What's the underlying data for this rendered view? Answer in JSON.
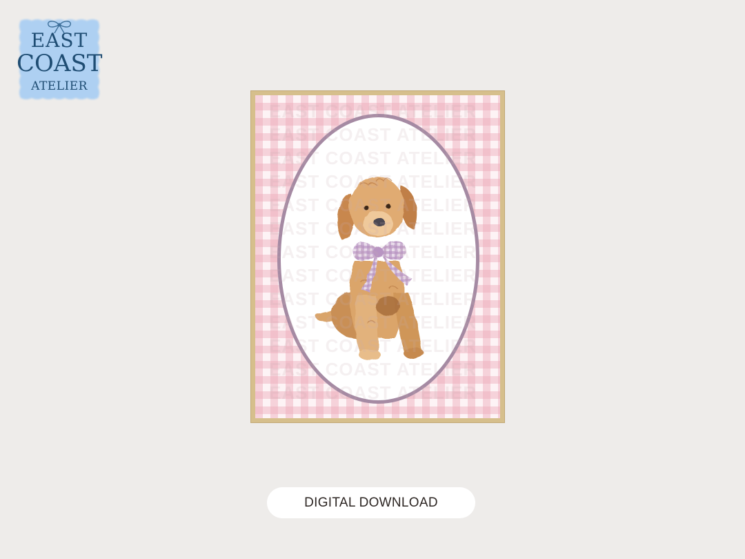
{
  "logo": {
    "line1": "EAST",
    "line2": "COAST",
    "line3": "ATELIER",
    "icon": "bow-icon",
    "bg_color": "#aed0f2",
    "text_color": "#1f4d73"
  },
  "print": {
    "subject": "watercolor-dog-with-gingham-bow",
    "watermark_text": "EAST COAST ATELIER",
    "frame_color": "#d6bf8c",
    "gingham_color": "#f2c4ce",
    "oval_border_color": "#a58aa3"
  },
  "badge": {
    "label": "DIGITAL DOWNLOAD"
  }
}
